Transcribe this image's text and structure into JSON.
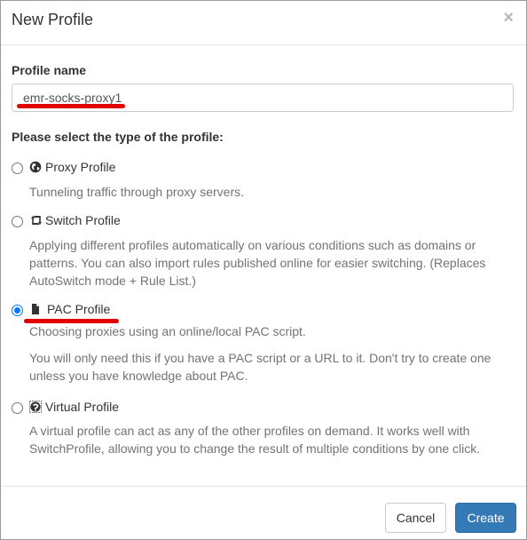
{
  "dialog": {
    "title": "New Profile",
    "close_glyph": "×"
  },
  "form": {
    "name_label": "Profile name",
    "name_value": "emr-socks-proxy1",
    "type_prompt": "Please select the type of the profile:"
  },
  "options": [
    {
      "label": "Proxy Profile",
      "icon": "globe-icon",
      "checked": false,
      "help": [
        "Tunneling traffic through proxy servers."
      ]
    },
    {
      "label": "Switch Profile",
      "icon": "retweet-icon",
      "checked": false,
      "help": [
        "Applying different profiles automatically on various conditions such as domains or patterns. You can also import rules published online for easier switching. (Replaces AutoSwitch mode + Rule List.)"
      ]
    },
    {
      "label": "PAC Profile",
      "icon": "file-icon",
      "checked": true,
      "help": [
        "Choosing proxies using an online/local PAC script.",
        "You will only need this if you have a PAC script or a URL to it. Don't try to create one unless you have knowledge about PAC."
      ]
    },
    {
      "label": "Virtual Profile",
      "icon": "virtual-profile-icon",
      "checked": false,
      "help": [
        "A virtual profile can act as any of the other profiles on demand. It works well with SwitchProfile, allowing you to change the result of multiple conditions by one click."
      ]
    }
  ],
  "footer": {
    "cancel_label": "Cancel",
    "create_label": "Create"
  },
  "colors": {
    "primary": "#337ab7",
    "annotation": "#e00000",
    "radio_checked": "#0075ff"
  }
}
